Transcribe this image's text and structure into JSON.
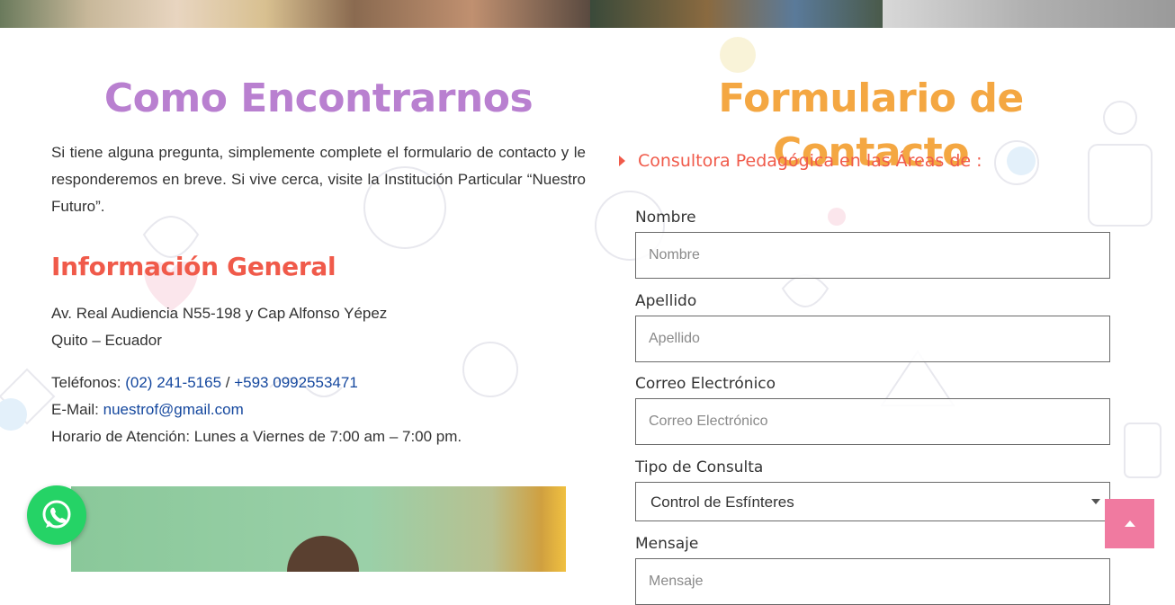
{
  "left": {
    "title": "Como Encontrarnos",
    "intro": "Si tiene alguna pregunta, simplemente complete el formulario de contacto y le responderemos en breve. Si vive cerca, visite la Institución Particular “Nuestro Futuro”.",
    "info_title": "Información General",
    "address_line1": "Av. Real Audiencia N55-198 y Cap Alfonso Yépez",
    "address_line2": "Quito – Ecuador",
    "phones_label": "Teléfonos: ",
    "phone1": "(02) 241-5165",
    "phone_sep": " / ",
    "phone2": "+593 0992553471",
    "email_label": "E-Mail: ",
    "email": "nuestrof@gmail.com",
    "hours": "Horario de Atención: Lunes a Viernes de 7:00 am – 7:00 pm."
  },
  "right": {
    "title": "Formulario de Contacto",
    "subhead": "Consultora Pedagógica en las Áreas de :",
    "fields": {
      "nombre_label": "Nombre",
      "nombre_placeholder": "Nombre",
      "apellido_label": "Apellido",
      "apellido_placeholder": "Apellido",
      "correo_label": "Correo Electrónico",
      "correo_placeholder": "Correo Electrónico",
      "tipo_label": "Tipo de Consulta",
      "tipo_selected": "Control de Esfínteres",
      "mensaje_label": "Mensaje",
      "mensaje_placeholder": "Mensaje"
    }
  },
  "colors": {
    "title_left": "#b980d0",
    "title_right": "#f4a742",
    "accent_red": "#f05a4a",
    "link": "#14479e",
    "whatsapp": "#25d366",
    "scroll_top": "#f07aa0"
  },
  "icons": {
    "whatsapp": "whatsapp-icon",
    "scroll_top": "arrow-up-icon",
    "subhead_caret": "caret-right-icon",
    "select_arrow": "chevron-down-icon"
  }
}
